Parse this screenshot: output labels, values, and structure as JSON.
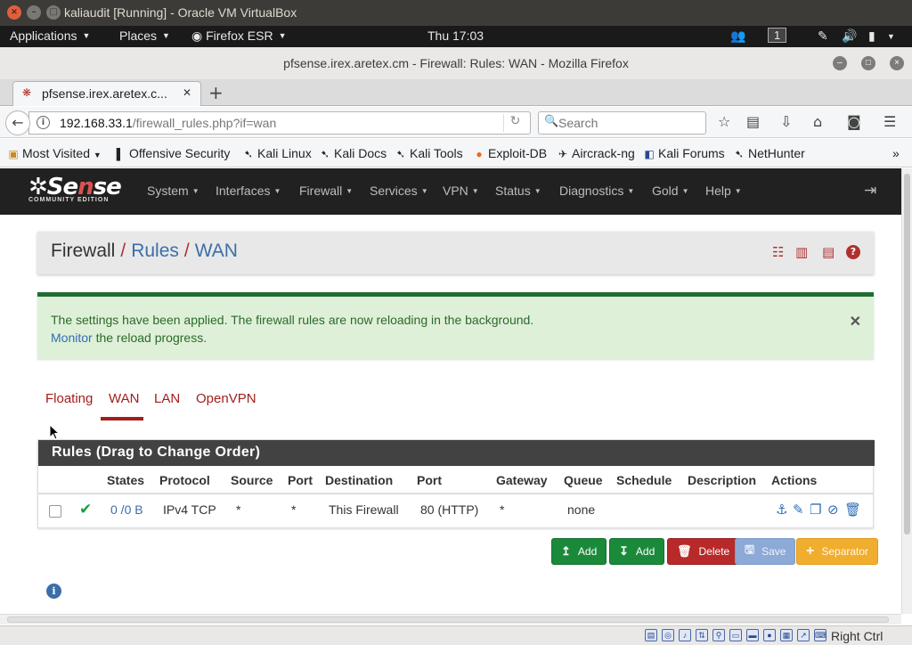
{
  "vbox": {
    "title": "kaliaudit [Running] - Oracle VM VirtualBox",
    "status_host_key": "Right Ctrl"
  },
  "gnome": {
    "applications": "Applications",
    "places": "Places",
    "firefox": "Firefox ESR",
    "clock": "Thu 17:03",
    "workspace": "1"
  },
  "firefox": {
    "window_title": "pfsense.irex.aretex.cm - Firewall: Rules: WAN - Mozilla Firefox",
    "tab_title": "pfsense.irex.aretex.c...",
    "url_host": "192.168.33.1",
    "url_rest": "/firewall_rules.php?if=wan",
    "search_placeholder": "Search"
  },
  "bookmarks": [
    {
      "label": "Most Visited",
      "icon": "folder-icon"
    },
    {
      "label": "Offensive Security",
      "icon": "offsec-icon"
    },
    {
      "label": "Kali Linux",
      "icon": "kali-icon"
    },
    {
      "label": "Kali Docs",
      "icon": "kali-icon"
    },
    {
      "label": "Kali Tools",
      "icon": "kali-icon"
    },
    {
      "label": "Exploit-DB",
      "icon": "exploitdb-icon"
    },
    {
      "label": "Aircrack-ng",
      "icon": "aircrack-icon"
    },
    {
      "label": "Kali Forums",
      "icon": "kali-forums-icon"
    },
    {
      "label": "NetHunter",
      "icon": "kali-icon"
    }
  ],
  "pfsense": {
    "logo_word_1": "Se",
    "logo_word_red": "n",
    "logo_word_2": "se",
    "logo_sub": "COMMUNITY EDITION",
    "menu": [
      "System",
      "Interfaces",
      "Firewall",
      "Services",
      "VPN",
      "Status",
      "Diagnostics",
      "Gold",
      "Help"
    ]
  },
  "breadcrumb": {
    "part1": "Firewall",
    "sep": "/",
    "part2": "Rules",
    "part3": "WAN"
  },
  "alert": {
    "line1": "The settings have been applied. The firewall rules are now reloading in the background.",
    "link": "Monitor",
    "line2_rest": " the reload progress."
  },
  "tabs": [
    "Floating",
    "WAN",
    "LAN",
    "OpenVPN"
  ],
  "active_tab": "WAN",
  "rules": {
    "title": "Rules (Drag to Change Order)",
    "columns": [
      "States",
      "Protocol",
      "Source",
      "Port",
      "Destination",
      "Port",
      "Gateway",
      "Queue",
      "Schedule",
      "Description",
      "Actions"
    ],
    "rows": [
      {
        "states": "0 /0 B",
        "protocol": "IPv4 TCP",
        "source": "*",
        "port": "*",
        "destination": "This Firewall",
        "dest_port": "80 (HTTP)",
        "gateway": "*",
        "queue": "none",
        "schedule": "",
        "description": ""
      }
    ]
  },
  "buttons": {
    "add_top": "Add",
    "add_bottom": "Add",
    "delete": "Delete",
    "save": "Save",
    "separator": "Separator"
  },
  "colors": {
    "pfsense_red": "#a31d1d",
    "link_blue": "#3c6ea8",
    "success_green": "#1a8a3a",
    "nav_dark": "#212121"
  }
}
